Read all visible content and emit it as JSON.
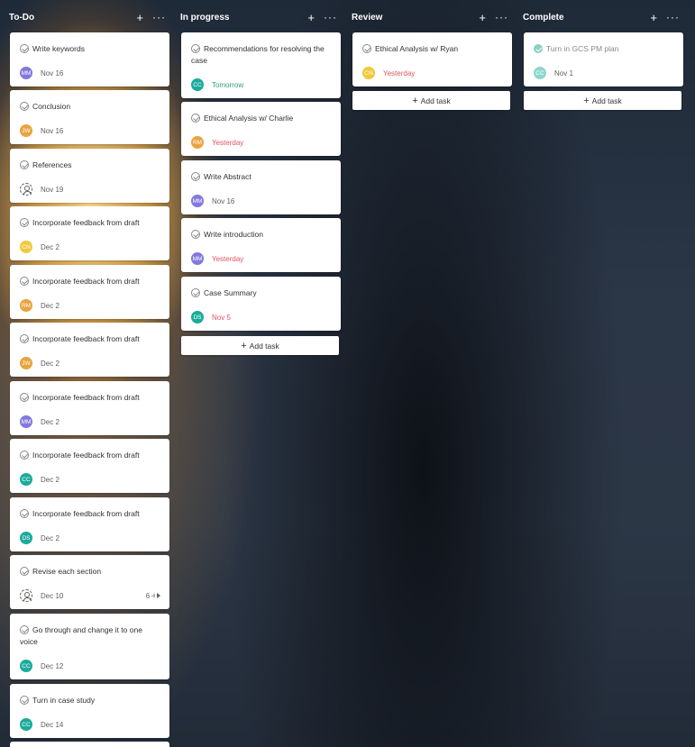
{
  "columns": [
    {
      "title": "To-Do",
      "add_icon": "+",
      "more_icon": "···",
      "tasks": [
        {
          "title": "Write keywords",
          "assignee": "MM",
          "due": "Nov 16",
          "due_status": "normal",
          "avatar_color": "#8378de"
        },
        {
          "title": "Conclusion",
          "assignee": "JW",
          "due": "Nov 16",
          "due_status": "normal",
          "avatar_color": "#e8a440"
        },
        {
          "title": "References",
          "assignee": "",
          "due": "Nov 19",
          "due_status": "normal",
          "avatar_color": "unassigned"
        },
        {
          "title": "Incorporate feedback from draft",
          "assignee": "CN",
          "due": "Dec 2",
          "due_status": "normal",
          "avatar_color": "#f0c93a"
        },
        {
          "title": "Incorporate feedback from draft",
          "assignee": "RM",
          "due": "Dec 2",
          "due_status": "normal",
          "avatar_color": "#e8a440"
        },
        {
          "title": "Incorporate feedback from draft",
          "assignee": "JW",
          "due": "Dec 2",
          "due_status": "normal",
          "avatar_color": "#e8a440"
        },
        {
          "title": "Incorporate feedback from draft",
          "assignee": "MM",
          "due": "Dec 2",
          "due_status": "normal",
          "avatar_color": "#8378de"
        },
        {
          "title": "Incorporate feedback from draft",
          "assignee": "CC",
          "due": "Dec 2",
          "due_status": "normal",
          "avatar_color": "#1aab9b"
        },
        {
          "title": "Incorporate feedback from draft",
          "assignee": "DS",
          "due": "Dec 2",
          "due_status": "normal",
          "avatar_color": "#1aab9b"
        },
        {
          "title": "Revise each section",
          "assignee": "",
          "due": "Dec 10",
          "due_status": "normal",
          "avatar_color": "unassigned",
          "subtasks": "6"
        },
        {
          "title": "Go through and change it to one voice",
          "assignee": "CC",
          "due": "Dec 12",
          "due_status": "normal",
          "avatar_color": "#1aab9b"
        },
        {
          "title": "Turn in case study",
          "assignee": "CC",
          "due": "Dec 14",
          "due_status": "normal",
          "avatar_color": "#1aab9b"
        }
      ]
    },
    {
      "title": "In progress",
      "add_icon": "+",
      "more_icon": "···",
      "tasks": [
        {
          "title": "Recommendations for resolving the case",
          "assignee": "CC",
          "due": "Tomorrow",
          "due_status": "soon",
          "avatar_color": "#1aab9b"
        },
        {
          "title": "Ethical Analysis w/ Charlie",
          "assignee": "RM",
          "due": "Yesterday",
          "due_status": "late",
          "avatar_color": "#e8a440"
        },
        {
          "title": "Write Abstract",
          "assignee": "MM",
          "due": "Nov 16",
          "due_status": "normal",
          "avatar_color": "#8378de"
        },
        {
          "title": "Write introduction",
          "assignee": "MM",
          "due": "Yesterday",
          "due_status": "late",
          "avatar_color": "#8378de"
        },
        {
          "title": "Case Summary",
          "assignee": "DS",
          "due": "Nov 5",
          "due_status": "late",
          "avatar_color": "#1aab9b"
        }
      ],
      "add_task_label": "Add task"
    },
    {
      "title": "Review",
      "add_icon": "+",
      "more_icon": "···",
      "tasks": [
        {
          "title": "Ethical Analysis w/ Ryan",
          "assignee": "CN",
          "due": "Yesterday",
          "due_status": "late",
          "avatar_color": "#f0c93a"
        }
      ],
      "add_task_label": "Add task"
    },
    {
      "title": "Complete",
      "add_icon": "+",
      "more_icon": "···",
      "tasks": [
        {
          "title": "Turn in GCS PM plan",
          "assignee": "CC",
          "due": "Nov 1",
          "due_status": "normal",
          "avatar_color": "#8fd6cc",
          "completed": true
        }
      ],
      "add_task_label": "Add task"
    }
  ],
  "icons": {
    "check": "check-circle-icon",
    "add": "plus-icon",
    "more": "more-icon",
    "unassigned": "unassigned-person-icon",
    "subtasks": "subtasks-icon"
  },
  "colors": {
    "late": "#e0555f",
    "soon": "#2e9e6e",
    "header_text": "#ffffff"
  }
}
